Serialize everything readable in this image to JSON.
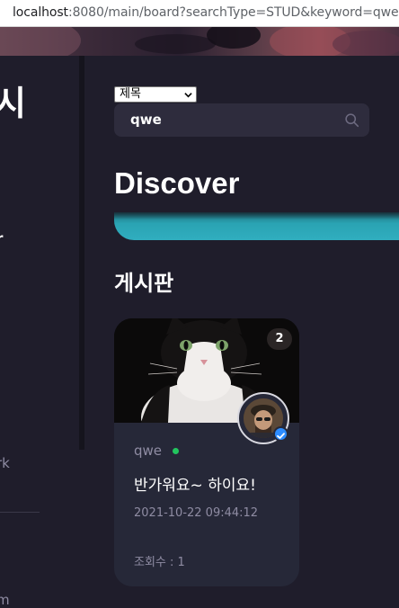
{
  "browser": {
    "url_host": "localhost",
    "url_rest": ":8080/main/board?searchType=STUD&keyword=qwe"
  },
  "sidebar": {
    "title_fragment": "시",
    "items": [
      {
        "label": "r",
        "active": true
      },
      {
        "label": "rk",
        "active": false
      },
      {
        "label": "m",
        "active": false
      }
    ]
  },
  "search": {
    "type_options": [
      "제목"
    ],
    "type_selected": "제목",
    "keyword": "qwe"
  },
  "discover": {
    "heading": "Discover"
  },
  "board": {
    "heading": "게시판",
    "posts": [
      {
        "comment_count": "2",
        "author": "qwe",
        "online": true,
        "title": "반가워요~ 하이요!",
        "date": "2021-10-22 09:44:12",
        "views": "조회수 : 1"
      }
    ]
  },
  "colors": {
    "background": "#1f1d2b",
    "card": "#262838",
    "accent_teal": "#30aebf",
    "online": "#22c55e",
    "verified": "#2d8cff"
  }
}
